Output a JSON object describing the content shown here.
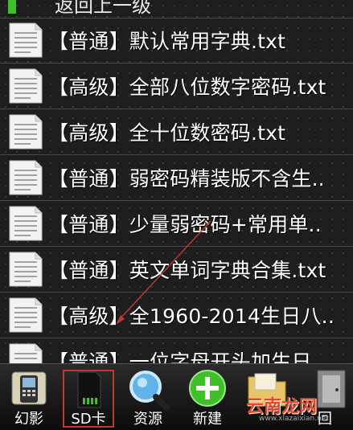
{
  "back_row": {
    "label": "返回上一级"
  },
  "files": [
    {
      "name": "【普通】默认常用字典.txt"
    },
    {
      "name": "【高级】全部八位数字密码.txt"
    },
    {
      "name": "【高级】全十位数密码.txt"
    },
    {
      "name": "【普通】弱密码精装版不含生.."
    },
    {
      "name": "【普通】少量弱密码+常用单.."
    },
    {
      "name": "【普通】英文单词字典合集.txt"
    },
    {
      "name": "【高级】全1960-2014生日八.."
    },
    {
      "name": "【普通】一位字母开头加生日"
    }
  ],
  "dock": {
    "items": [
      {
        "label": "幻影",
        "icon": "phone-icon"
      },
      {
        "label": "SD卡",
        "icon": "sd-card-icon"
      },
      {
        "label": "资源",
        "icon": "magnifier-icon"
      },
      {
        "label": "新建",
        "icon": "plus-icon"
      },
      {
        "label": "",
        "icon": "folder-icon"
      },
      {
        "label": "回",
        "icon": "exit-icon"
      }
    ]
  },
  "watermark": {
    "text": "云南龙网",
    "sub": "www.xlazaixian.net"
  },
  "colors": {
    "accent_green": "#3fbf2a",
    "highlight_red": "#c0392b"
  }
}
